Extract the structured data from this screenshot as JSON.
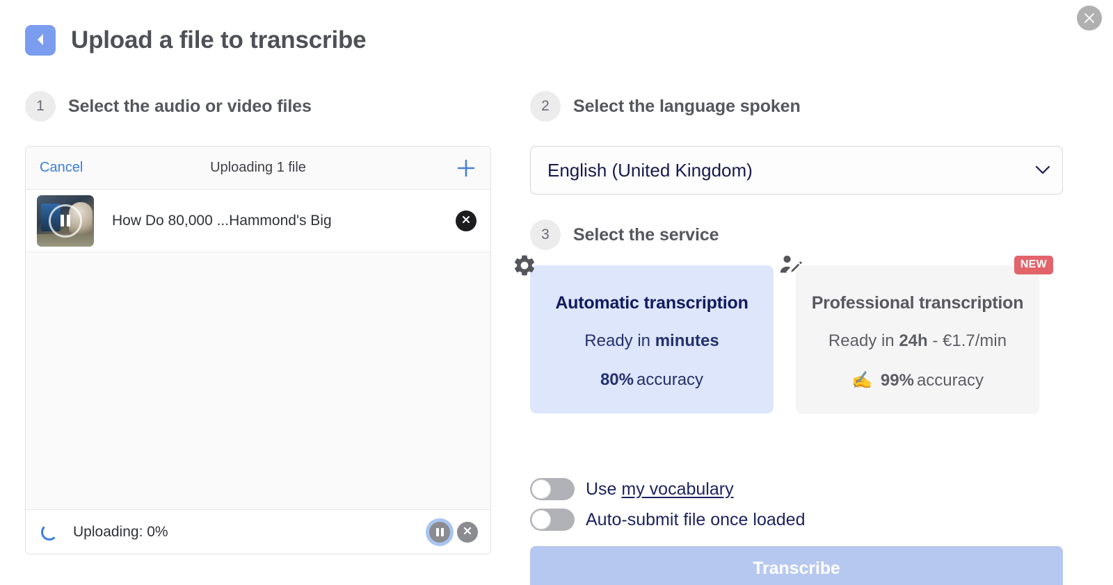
{
  "header": {
    "title": "Upload a file to transcribe",
    "back_icon": "chevron-left-icon",
    "close_icon": "close-icon"
  },
  "accent": {
    "brand_blue": "#7b9df0",
    "link_blue": "#3b7ddd",
    "navy": "#161a4c",
    "badge_red": "#e2636a",
    "selected_card_bg": "#dde6fb",
    "button_disabled": "#b6c8f0"
  },
  "steps": {
    "one": {
      "number": "1",
      "label": "Select the audio or video files"
    },
    "two": {
      "number": "2",
      "label": "Select the language spoken"
    },
    "three": {
      "number": "3",
      "label": "Select the service"
    }
  },
  "file_panel": {
    "cancel_label": "Cancel",
    "status_title": "Uploading 1 file",
    "add_icon": "plus-icon",
    "files": [
      {
        "name": "How Do 80,000 ...Hammond's Big",
        "thumbnail_icon": "video-pause-icon",
        "remove_icon": "close-circle-icon"
      }
    ],
    "footer": {
      "spinner_icon": "loading-spinner-icon",
      "progress_text": "Uploading: 0%",
      "pause_icon": "pause-icon",
      "stop_icon": "stop-circle-icon"
    }
  },
  "language": {
    "selected": "English (United Kingdom)",
    "chevron_icon": "chevron-down-icon",
    "options": [
      "English (United Kingdom)"
    ]
  },
  "services": [
    {
      "id": "automatic",
      "icon": "gear-icon",
      "title": "Automatic transcription",
      "ready_prefix": "Ready in ",
      "ready_value": "minutes",
      "ready_suffix": "",
      "accuracy_emoji": "",
      "accuracy_value": "80%",
      "accuracy_label": " accuracy",
      "selected": true,
      "badge": ""
    },
    {
      "id": "professional",
      "icon": "person-edit-icon",
      "title": "Professional transcription",
      "ready_prefix": "Ready in ",
      "ready_value": "24h",
      "ready_suffix": " - €1.7/min",
      "accuracy_emoji": "✍️",
      "accuracy_value": "99%",
      "accuracy_label": " accuracy",
      "selected": false,
      "badge": "NEW"
    }
  ],
  "options": {
    "vocabulary": {
      "prefix": "Use ",
      "link": "my vocabulary",
      "enabled": false
    },
    "auto_submit": {
      "label": "Auto-submit file once loaded",
      "enabled": false
    }
  },
  "submit": {
    "label": "Transcribe",
    "enabled": false
  }
}
